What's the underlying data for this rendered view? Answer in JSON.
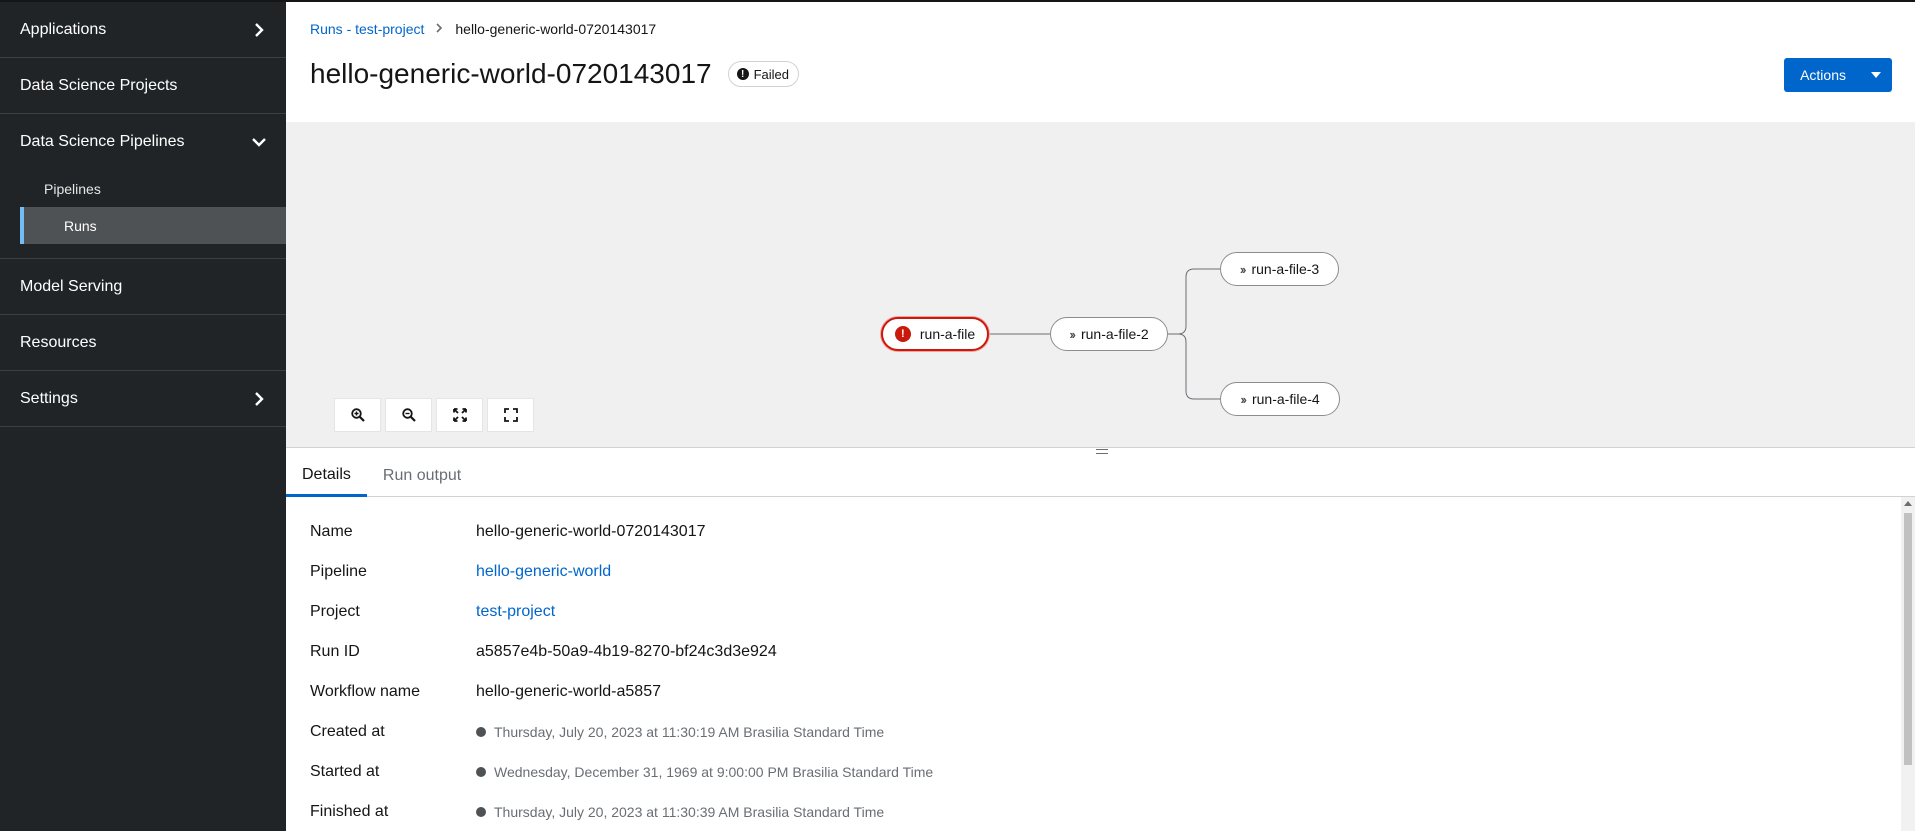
{
  "sidebar": {
    "items": [
      {
        "label": "Applications"
      },
      {
        "label": "Data Science Projects"
      },
      {
        "label": "Data Science Pipelines"
      },
      {
        "label": "Model Serving"
      },
      {
        "label": "Resources"
      },
      {
        "label": "Settings"
      }
    ],
    "pipelines_sub": [
      {
        "label": "Pipelines"
      },
      {
        "label": "Runs"
      }
    ],
    "active_sub": "Runs"
  },
  "header": {
    "breadcrumb": {
      "parent": "Runs - test-project",
      "current": "hello-generic-world-0720143017"
    },
    "title": "hello-generic-world-0720143017",
    "status": "Failed",
    "actions_label": "Actions"
  },
  "graph": {
    "nodes": [
      {
        "id": "run-a-file",
        "label": "run-a-file",
        "state": "failed"
      },
      {
        "id": "run-a-file-2",
        "label": "run-a-file-2",
        "state": "pending"
      },
      {
        "id": "run-a-file-3",
        "label": "run-a-file-3",
        "state": "pending"
      },
      {
        "id": "run-a-file-4",
        "label": "run-a-file-4",
        "state": "pending"
      }
    ],
    "edges": [
      [
        "run-a-file",
        "run-a-file-2"
      ],
      [
        "run-a-file-2",
        "run-a-file-3"
      ],
      [
        "run-a-file-2",
        "run-a-file-4"
      ]
    ]
  },
  "tabs": [
    {
      "label": "Details"
    },
    {
      "label": "Run output"
    }
  ],
  "active_tab": "Details",
  "details": {
    "name": {
      "label": "Name",
      "value": "hello-generic-world-0720143017"
    },
    "pipeline": {
      "label": "Pipeline",
      "value": "hello-generic-world"
    },
    "project": {
      "label": "Project",
      "value": "test-project"
    },
    "run_id": {
      "label": "Run ID",
      "value": "a5857e4b-50a9-4b19-8270-bf24c3d3e924"
    },
    "workflow_name": {
      "label": "Workflow name",
      "value": "hello-generic-world-a5857"
    },
    "created_at": {
      "label": "Created at",
      "value": "Thursday, July 20, 2023 at 11:30:19 AM Brasilia Standard Time"
    },
    "started_at": {
      "label": "Started at",
      "value": "Wednesday, December 31, 1969 at 9:00:00 PM Brasilia Standard Time"
    },
    "finished_at": {
      "label": "Finished at",
      "value": "Thursday, July 20, 2023 at 11:30:39 AM Brasilia Standard Time"
    }
  },
  "colors": {
    "accent": "#0066cc",
    "failed": "#c9190b",
    "sidebar_bg": "#212427",
    "active_marker": "#73bcf7"
  }
}
